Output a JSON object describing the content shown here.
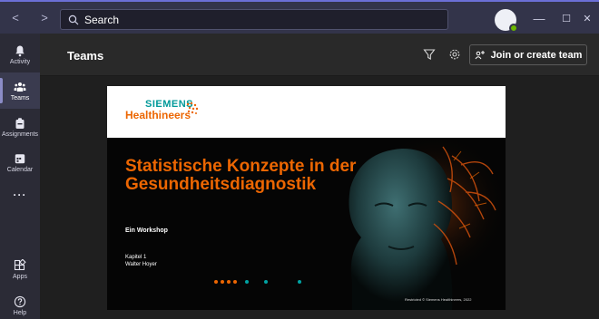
{
  "search": {
    "placeholder": "Search"
  },
  "window": {
    "min": "—",
    "max": "☐",
    "close": "✕"
  },
  "rail": {
    "items": [
      {
        "label": "Activity",
        "icon": "bell-icon"
      },
      {
        "label": "Teams",
        "icon": "teams-icon",
        "active": true
      },
      {
        "label": "Assignments",
        "icon": "assignments-icon"
      },
      {
        "label": "Calendar",
        "icon": "calendar-icon"
      },
      {
        "label": "···",
        "icon": "more-icon"
      },
      {
        "label": "Apps",
        "icon": "apps-icon"
      },
      {
        "label": "Help",
        "icon": "help-icon"
      }
    ]
  },
  "header": {
    "title": "Teams",
    "join_label": "Join or create team"
  },
  "slide": {
    "brand_top": "SIEMENS",
    "brand_bottom": "Healthineers",
    "title": "Statistische Konzepte in der Gesundheitsdiagnostik",
    "subtitle": "Ein Workshop",
    "chapter": "Kapitel 1",
    "author": "Walter Hoyer",
    "footer": "Restricted © Siemens Healthineers, 2022"
  },
  "colors": {
    "titlebar": "#33344a",
    "rail": "#2b2b36",
    "accent": "#8b8cc7",
    "siemens_teal": "#009999",
    "healthineers_orange": "#ec6602",
    "presence": "#6bb700"
  }
}
